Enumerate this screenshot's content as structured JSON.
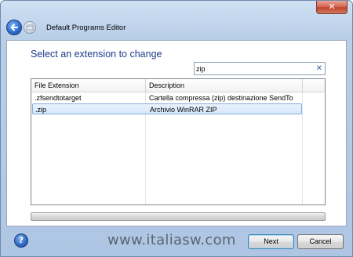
{
  "window": {
    "title": "Default Programs Editor",
    "close_symbol": "✕"
  },
  "page": {
    "heading": "Select an extension to change"
  },
  "search": {
    "value": "zip",
    "clear_symbol": "✕"
  },
  "list": {
    "columns": [
      "File Extension",
      "Description"
    ],
    "rows": [
      {
        "extension": ".zfsendtotarget",
        "description": "Cartella compressa (zip) destinazione SendTo",
        "selected": false
      },
      {
        "extension": ".zip",
        "description": "Archivio WinRAR ZIP",
        "selected": true
      }
    ]
  },
  "footer": {
    "help_symbol": "?",
    "watermark": "www.italiasw.com",
    "next_label": "Next",
    "cancel_label": "Cancel"
  },
  "icons": {
    "back": "back-arrow-icon",
    "forward": "program-icon",
    "help": "help-icon",
    "clear": "clear-search-icon"
  },
  "colors": {
    "heading": "#1e3b8a",
    "selection": "#d5e7fb",
    "selection_border": "#84acdd",
    "close_button": "#c0442c"
  }
}
